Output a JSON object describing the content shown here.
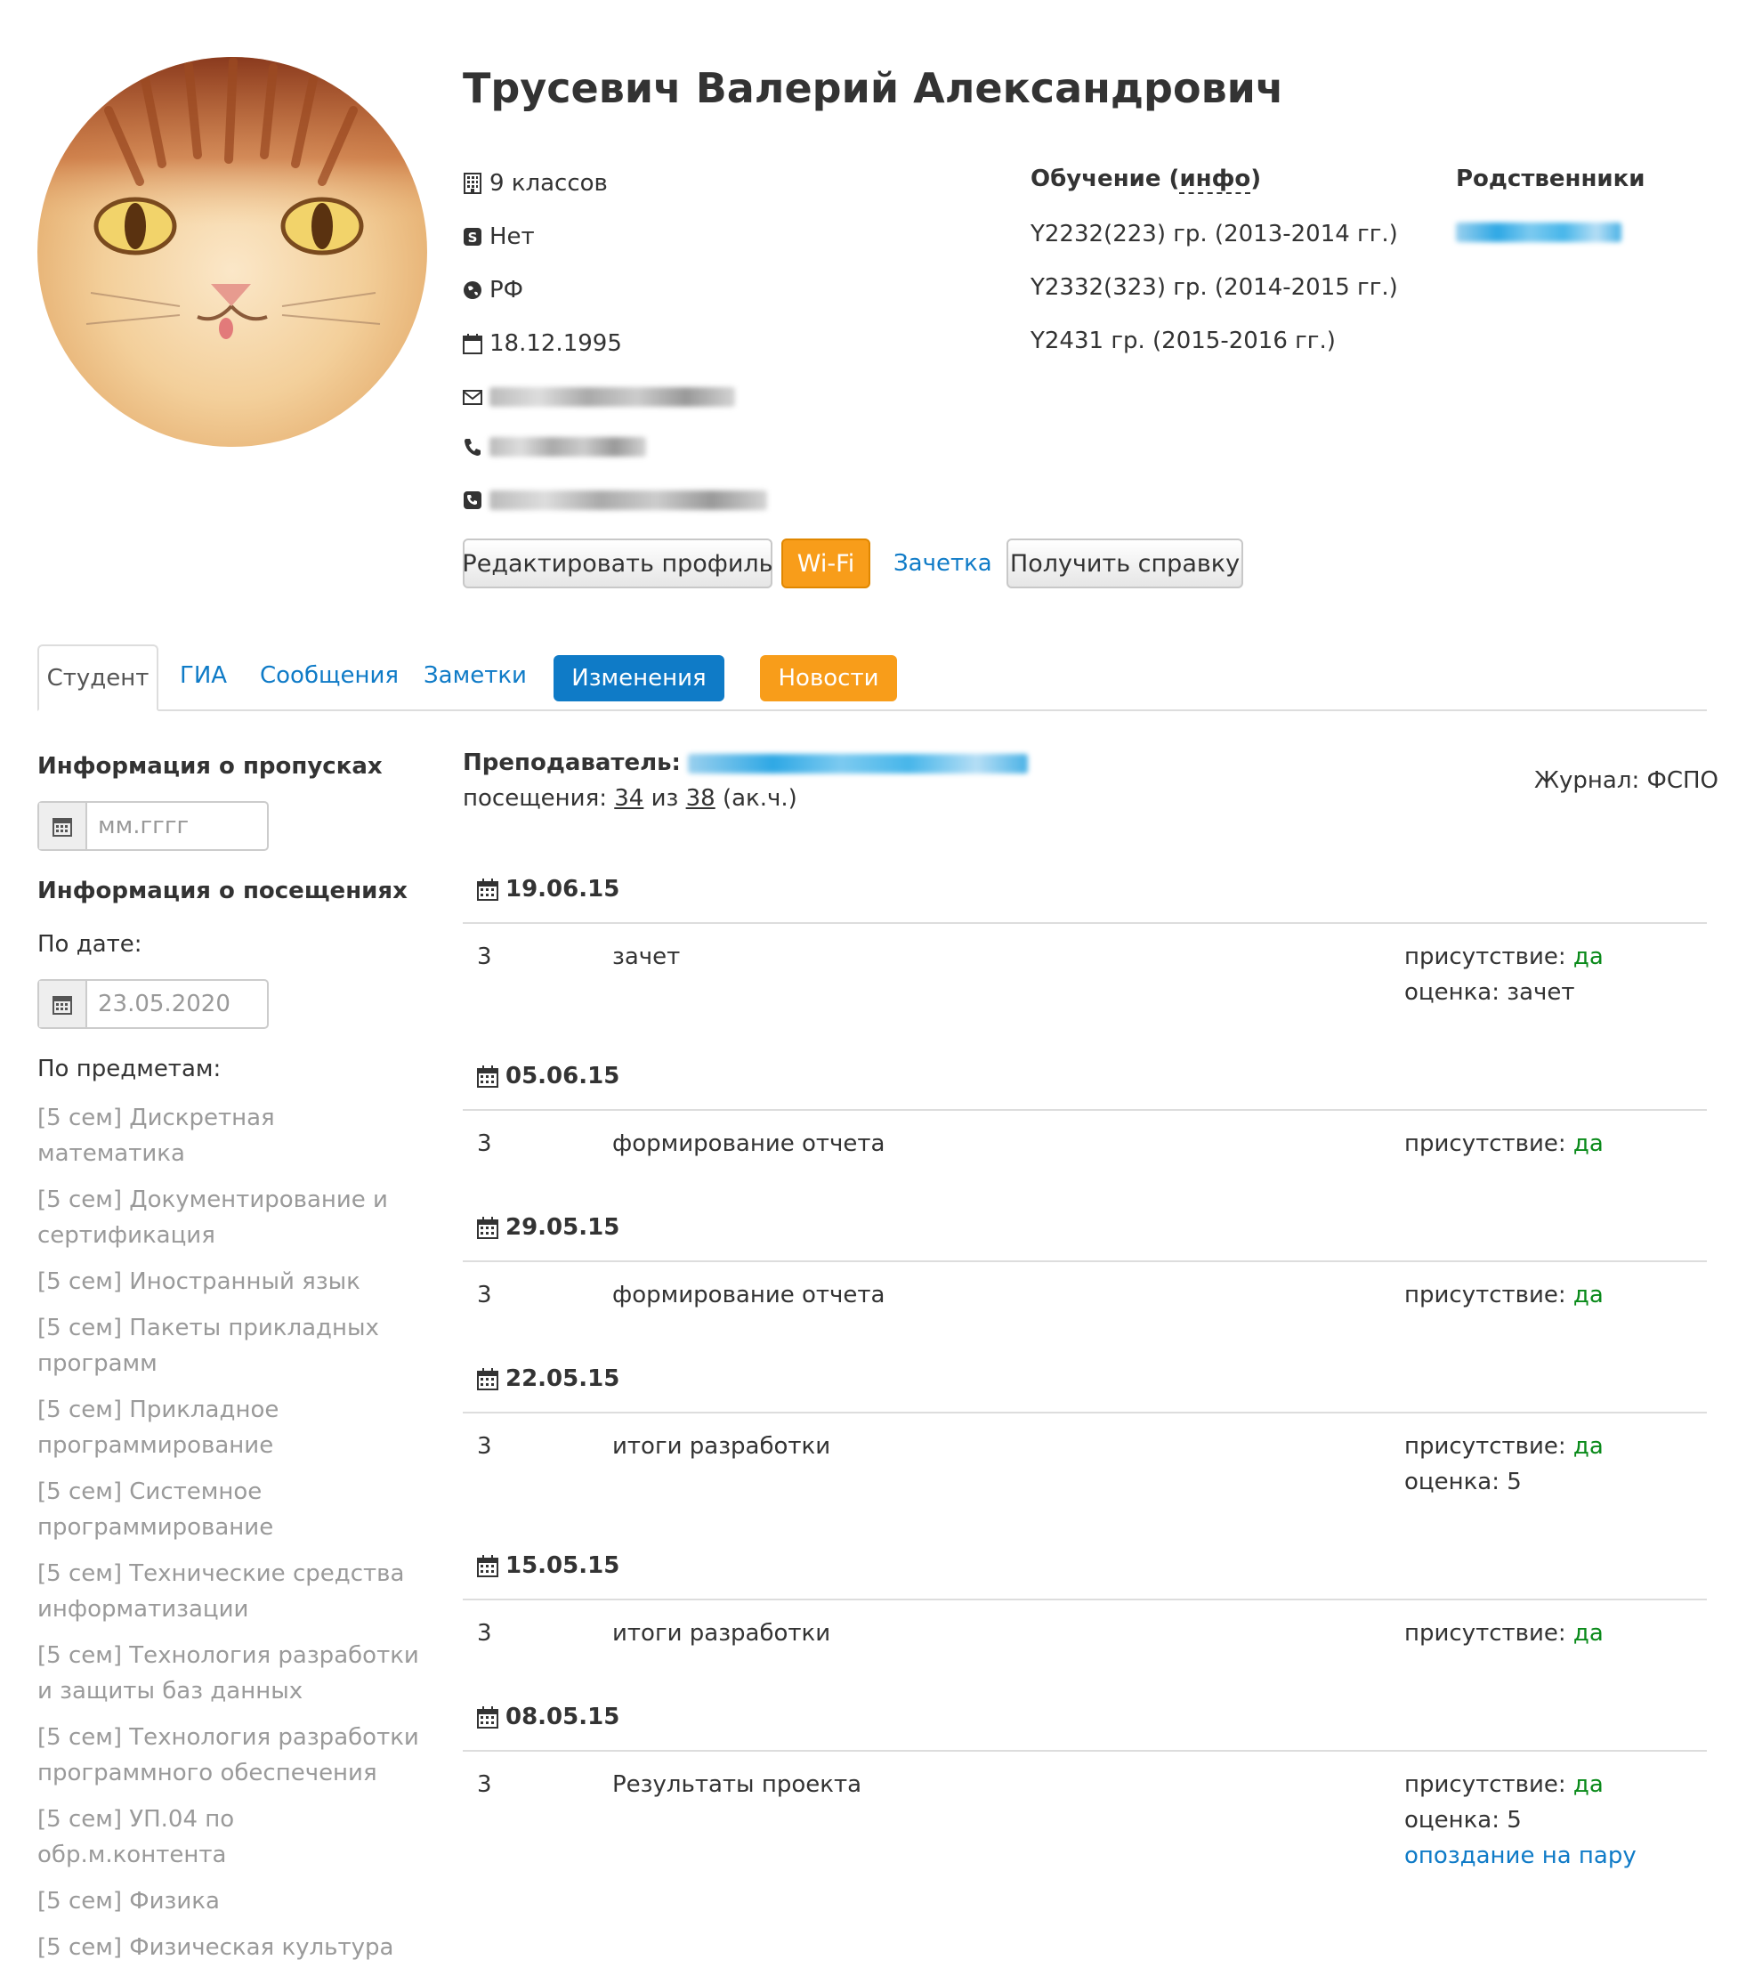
{
  "profile": {
    "name": "Трусевич Валерий Александрович",
    "education_level": "9 классов",
    "skype": "Нет",
    "citizenship": "РФ",
    "birth_date": "18.12.1995"
  },
  "study": {
    "title_prefix": "Обучение (",
    "title_link": "инфо",
    "title_suffix": ")",
    "groups": [
      "Y2232(223) гр. (2013-2014 гг.)",
      "Y2332(323) гр. (2014-2015 гг.)",
      "Y2431 гр. (2015-2016 гг.)"
    ]
  },
  "relatives": {
    "title": "Родственники"
  },
  "actions": {
    "edit_profile": "Редактировать профиль",
    "wifi": "Wi-Fi",
    "record_book": "Зачетка",
    "get_certificate": "Получить справку"
  },
  "tabs": {
    "student": "Студент",
    "gia": "ГИА",
    "messages": "Сообщения",
    "notes": "Заметки",
    "changes": "Изменения",
    "news": "Новости"
  },
  "sidebar": {
    "absences_title": "Информация о пропусках",
    "absences_placeholder": "мм.гггг",
    "visits_title": "Информация о посещениях",
    "by_date_label": "По дате:",
    "by_date_value": "23.05.2020",
    "by_subject_label": "По предметам:",
    "subjects": [
      "[5 сем] Дискретная математика",
      "[5 сем] Документирование и сертификация",
      "[5 сем] Иностранный язык",
      "[5 сем] Пакеты прикладных программ",
      "[5 сем] Прикладное программирование",
      "[5 сем] Системное программирование",
      "[5 сем] Технические средства информатизации",
      "[5 сем] Технология разработки и защиты баз данных",
      "[5 сем] Технология разработки программного обеспечения",
      "[5 сем] УП.04 по обр.м.контента",
      "[5 сем] Физика",
      "[5 сем] Физическая культура"
    ]
  },
  "main": {
    "teacher_label": "Преподаватель:",
    "visits_label": "посещения:",
    "visits_done": "34",
    "visits_of": "из",
    "visits_total": "38",
    "visits_unit": "(ак.ч.)",
    "journal": "Журнал: ФСПО",
    "presence_label": "присутствие:",
    "presence_yes": "да",
    "grade_label": "оценка:",
    "entries": [
      {
        "date": "19.06.15",
        "hours": "3",
        "topic": "зачет",
        "grade": "зачет"
      },
      {
        "date": "05.06.15",
        "hours": "3",
        "topic": "формирование отчета"
      },
      {
        "date": "29.05.15",
        "hours": "3",
        "topic": "формирование отчета"
      },
      {
        "date": "22.05.15",
        "hours": "3",
        "topic": "итоги разработки",
        "grade": "5"
      },
      {
        "date": "15.05.15",
        "hours": "3",
        "topic": "итоги разработки"
      },
      {
        "date": "08.05.15",
        "hours": "3",
        "topic": "Результаты проекта",
        "grade": "5",
        "note": "опоздание на пару"
      }
    ]
  },
  "colors": {
    "link": "#0f7bc7",
    "orange": "#f89d1a",
    "blue_pill": "#0f7bc7",
    "green": "#0a8a1a",
    "muted": "#9a9a9a"
  },
  "icons": [
    "building-icon",
    "skype-icon",
    "globe-icon",
    "calendar-icon",
    "envelope-icon",
    "phone-icon",
    "phone-square-icon"
  ]
}
